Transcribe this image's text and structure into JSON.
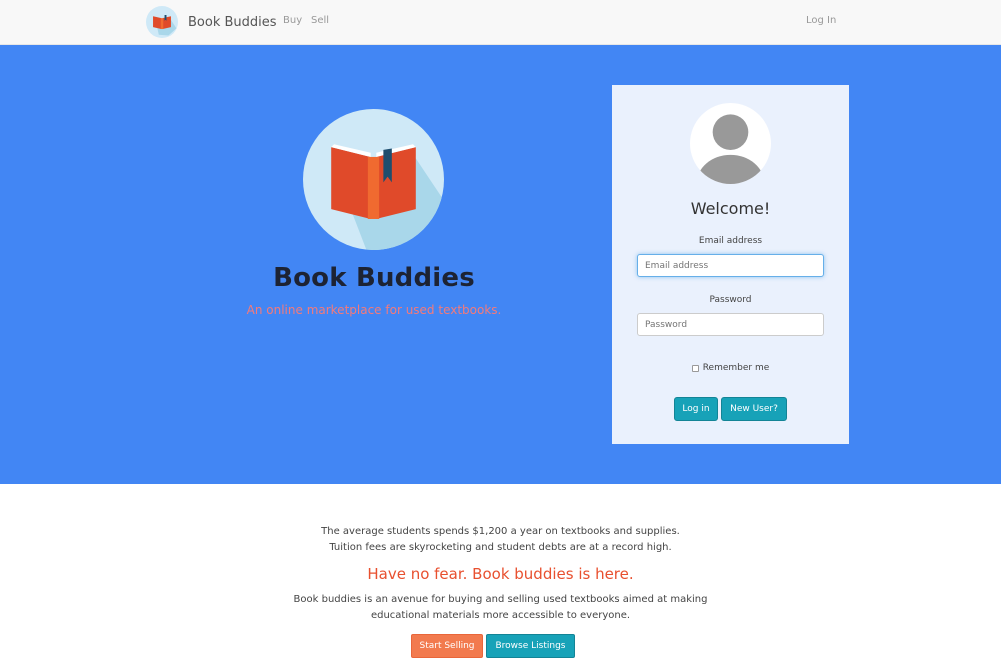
{
  "navbar": {
    "brand": "Book Buddies",
    "links": [
      "Buy",
      "Sell"
    ],
    "login": "Log In"
  },
  "hero": {
    "title": "Book Buddies",
    "subtitle": "An online marketplace for used textbooks."
  },
  "login_card": {
    "welcome": "Welcome!",
    "email_label": "Email address",
    "email_placeholder": "Email address",
    "password_label": "Password",
    "password_placeholder": "Password",
    "remember_label": "Remember me",
    "login_button": "Log in",
    "new_user_button": "New User?"
  },
  "info": {
    "line1": "The average students spends $1,200 a year on textbooks and supplies.",
    "line2": "Tuition fees are skyrocketing and student debts are at a record high.",
    "tagline": "Have no fear. Book buddies is here.",
    "desc1": "Book buddies is an avenue for buying and selling used textbooks aimed at making",
    "desc2": "educational materials more accessible to everyone.",
    "start_selling": "Start Selling",
    "browse_listings": "Browse Listings"
  },
  "colors": {
    "hero_bg": "#4286f4",
    "card_bg": "#eaf1fd",
    "teal_button": "#17a2b8",
    "orange_button": "#f27a4e",
    "tagline": "#e8502f",
    "subtitle": "#f47a7a"
  },
  "icons": [
    "book-logo-icon",
    "user-avatar-icon",
    "checkbox-icon"
  ]
}
